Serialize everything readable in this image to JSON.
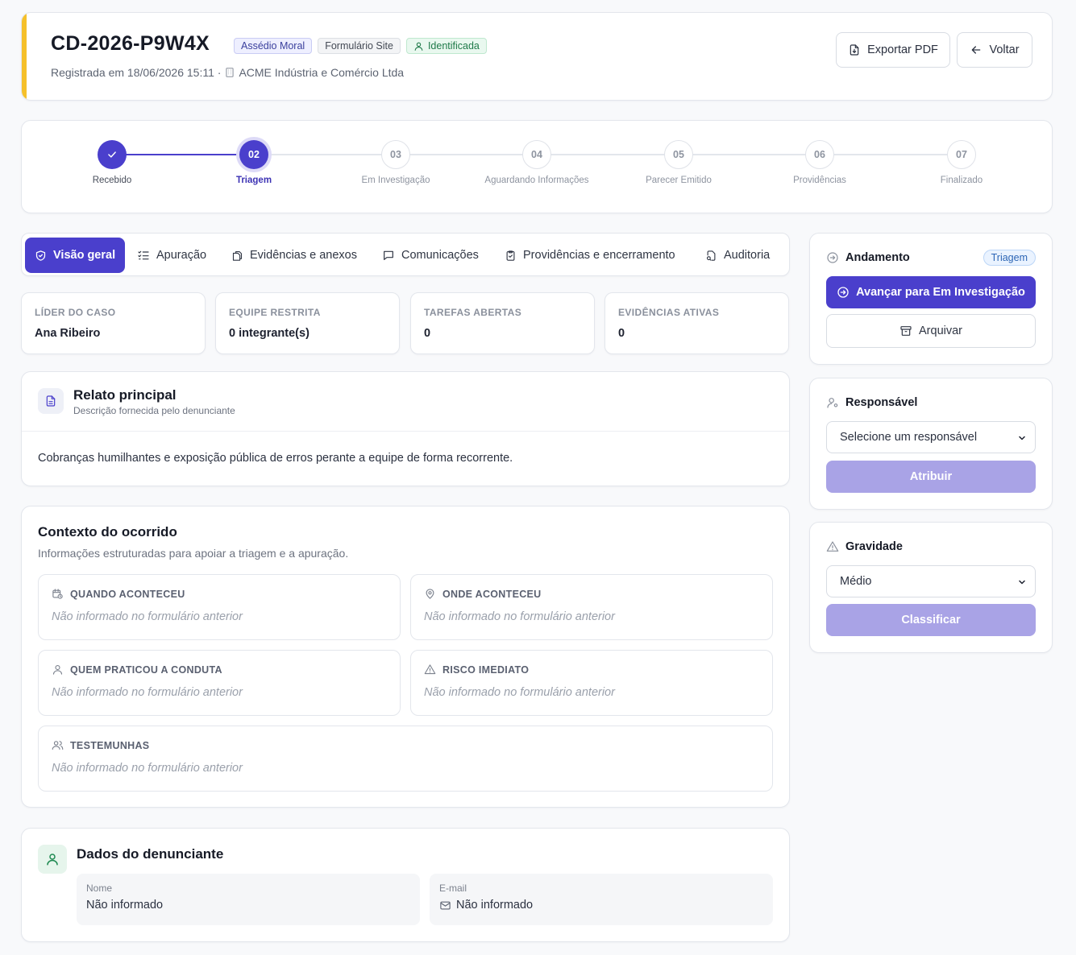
{
  "header": {
    "case_id": "CD-2026-P9W4X",
    "badges": {
      "category": "Assédio Moral",
      "source": "Formulário Site",
      "identified": "Identificada"
    },
    "registered": "Registrada em 18/06/2026 15:11 ·",
    "company": "ACME Indústria e Comércio Ltda",
    "export_label": "Exportar PDF",
    "back_label": "Voltar",
    "accent_color": "#f5c02a"
  },
  "stepper": {
    "current_index": 1,
    "steps": [
      {
        "num": "",
        "label": "Recebido",
        "state": "done"
      },
      {
        "num": "02",
        "label": "Triagem",
        "state": "current"
      },
      {
        "num": "03",
        "label": "Em Investigação",
        "state": "todo"
      },
      {
        "num": "04",
        "label": "Aguardando Informações",
        "state": "todo"
      },
      {
        "num": "05",
        "label": "Parecer Emitido",
        "state": "todo"
      },
      {
        "num": "06",
        "label": "Providências",
        "state": "todo"
      },
      {
        "num": "07",
        "label": "Finalizado",
        "state": "todo"
      }
    ]
  },
  "tabs": [
    {
      "label": "Visão geral",
      "icon": "shield-check-icon",
      "active": true
    },
    {
      "label": "Apuração",
      "icon": "list-checks-icon",
      "active": false
    },
    {
      "label": "Evidências e anexos",
      "icon": "files-icon",
      "active": false
    },
    {
      "label": "Comunicações",
      "icon": "chat-icon",
      "active": false
    },
    {
      "label": "Providências e encerramento",
      "icon": "clipboard-check-icon",
      "active": false
    },
    {
      "label": "Auditoria",
      "icon": "file-audit-icon",
      "active": false
    }
  ],
  "stats": [
    {
      "caption": "LÍDER DO CASO",
      "value": "Ana Ribeiro"
    },
    {
      "caption": "EQUIPE RESTRITA",
      "value": "0 integrante(s)"
    },
    {
      "caption": "TAREFAS ABERTAS",
      "value": "0"
    },
    {
      "caption": "EVIDÊNCIAS ATIVAS",
      "value": "0"
    }
  ],
  "relato": {
    "title": "Relato principal",
    "subtitle": "Descrição fornecida pelo denunciante",
    "body": "Cobranças humilhantes e exposição pública de erros perante a equipe de forma recorrente."
  },
  "contexto": {
    "title": "Contexto do ocorrido",
    "subtitle": "Informações estruturadas para apoiar a triagem e a apuração.",
    "items": [
      {
        "caption": "QUANDO ACONTECEU",
        "value": "Não informado no formulário anterior",
        "icon": "calendar-clock-icon"
      },
      {
        "caption": "ONDE ACONTECEU",
        "value": "Não informado no formulário anterior",
        "icon": "map-pin-icon"
      },
      {
        "caption": "QUEM PRATICOU A CONDUTA",
        "value": "Não informado no formulário anterior",
        "icon": "user-icon"
      },
      {
        "caption": "RISCO IMEDIATO",
        "value": "Não informado no formulário anterior",
        "icon": "warning-icon"
      },
      {
        "caption": "TESTEMUNHAS",
        "value": "Não informado no formulário anterior",
        "icon": "users-icon"
      }
    ]
  },
  "denunciante": {
    "title": "Dados do denunciante",
    "name_caption": "Nome",
    "name_value": "Não informado",
    "email_caption": "E-mail",
    "email_value": "Não informado"
  },
  "sidebar": {
    "andamento": {
      "title": "Andamento",
      "status": "Triagem",
      "advance_label": "Avançar para Em Investigação",
      "archive_label": "Arquivar"
    },
    "responsavel": {
      "title": "Responsável",
      "select_value": "Selecione um responsável",
      "assign_label": "Atribuir"
    },
    "gravidade": {
      "title": "Gravidade",
      "select_value": "Médio",
      "classify_label": "Classificar"
    }
  }
}
